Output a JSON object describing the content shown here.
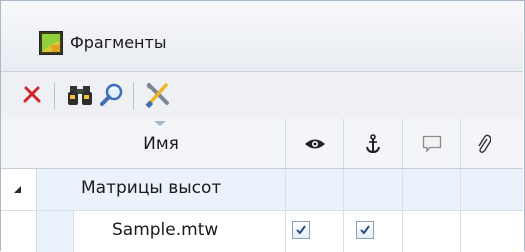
{
  "window": {
    "title": "Фрагменты"
  },
  "toolbar": {
    "buttons": [
      {
        "icon": "delete-icon",
        "color": "#d0232a"
      },
      {
        "icon": "binoculars-icon"
      },
      {
        "icon": "zoom-search-icon"
      },
      {
        "icon": "tools-icon"
      }
    ]
  },
  "grid": {
    "columns": {
      "name": "Имя",
      "visibility_icon": "eye-icon",
      "anchor_icon": "anchor-icon",
      "comment_icon": "comment-icon",
      "attachment_icon": "paperclip-icon"
    },
    "group": {
      "label": "Матрицы высот",
      "expanded": true
    },
    "rows": [
      {
        "name": "Sample.mtw",
        "visible": true,
        "anchored": true
      }
    ]
  },
  "colors": {
    "accent": "#3c6fb4",
    "header_bg": "#f3f5f8",
    "group_bg": "#eaf3fb"
  }
}
